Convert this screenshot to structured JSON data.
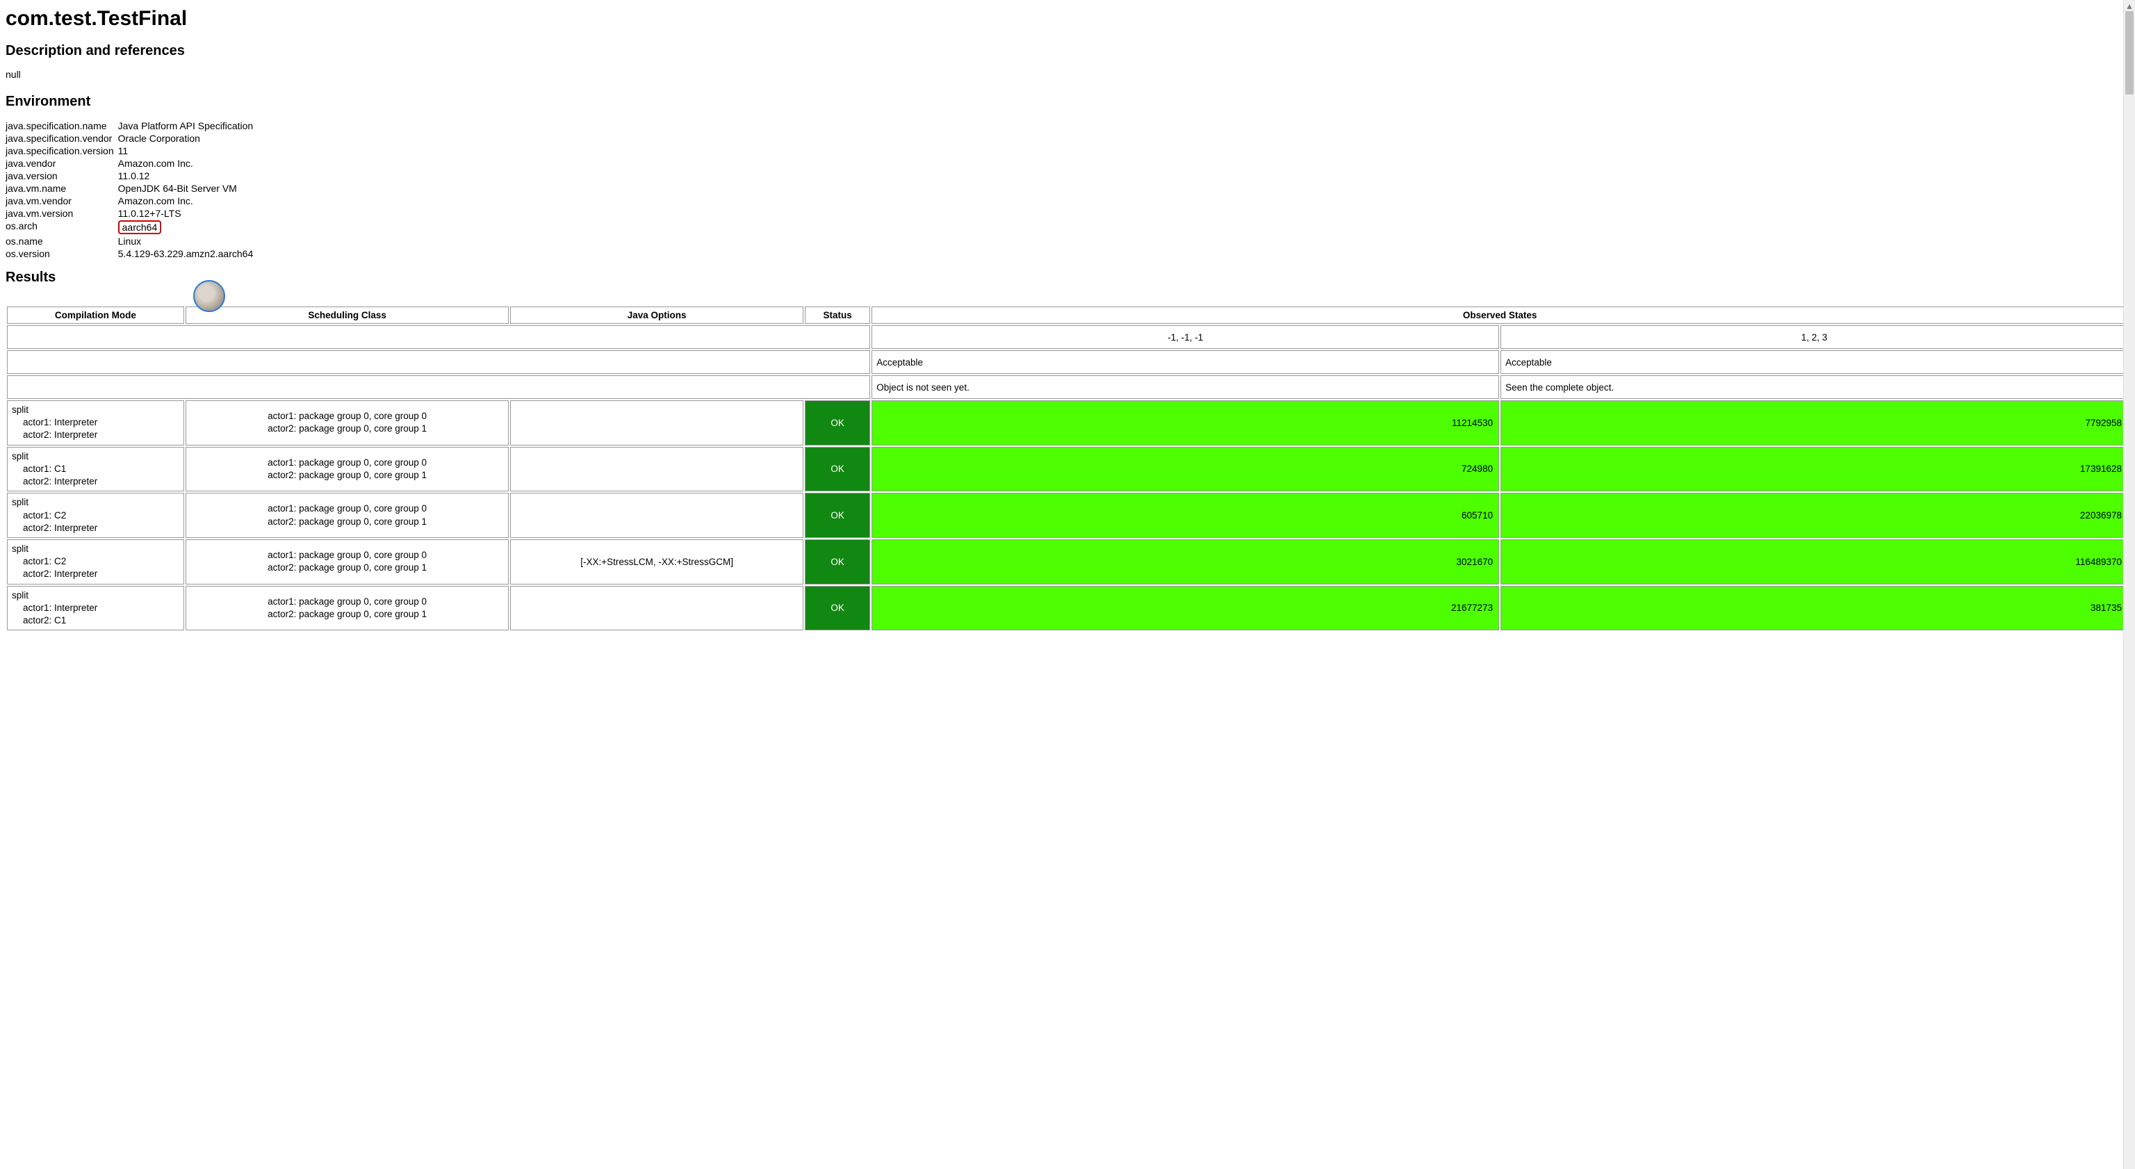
{
  "title": "com.test.TestFinal",
  "sections": {
    "description_heading": "Description and references",
    "description_text": "null",
    "environment_heading": "Environment",
    "results_heading": "Results"
  },
  "environment": [
    {
      "key": "java.specification.name",
      "value": "Java Platform API Specification"
    },
    {
      "key": "java.specification.vendor",
      "value": "Oracle Corporation"
    },
    {
      "key": "java.specification.version",
      "value": "11"
    },
    {
      "key": "java.vendor",
      "value": "Amazon.com Inc."
    },
    {
      "key": "java.version",
      "value": "11.0.12"
    },
    {
      "key": "java.vm.name",
      "value": "OpenJDK 64-Bit Server VM"
    },
    {
      "key": "java.vm.vendor",
      "value": "Amazon.com Inc."
    },
    {
      "key": "java.vm.version",
      "value": "11.0.12+7-LTS"
    },
    {
      "key": "os.arch",
      "value": "aarch64",
      "highlight": true
    },
    {
      "key": "os.name",
      "value": "Linux"
    },
    {
      "key": "os.version",
      "value": "5.4.129-63.229.amzn2.aarch64"
    }
  ],
  "results_table": {
    "headers": {
      "compilation_mode": "Compilation Mode",
      "scheduling_class": "Scheduling Class",
      "java_options": "Java Options",
      "status": "Status",
      "observed_states": "Observed States"
    },
    "observed_headers": [
      "-1, -1, -1",
      "1, 2, 3"
    ],
    "observed_acceptable": [
      "Acceptable",
      "Acceptable"
    ],
    "observed_desc": [
      "Object is not seen yet.",
      "Seen the complete object."
    ],
    "rows": [
      {
        "comp_line1": "split",
        "comp_actor1": "actor1: Interpreter",
        "comp_actor2": "actor2: Interpreter",
        "sched_actor1": "actor1: package group 0, core group 0",
        "sched_actor2": "actor2: package group 0, core group 1",
        "java_options": "",
        "status": "OK",
        "obs": [
          "11214530",
          "7792958"
        ]
      },
      {
        "comp_line1": "split",
        "comp_actor1": "actor1: C1",
        "comp_actor2": "actor2: Interpreter",
        "sched_actor1": "actor1: package group 0, core group 0",
        "sched_actor2": "actor2: package group 0, core group 1",
        "java_options": "",
        "status": "OK",
        "obs": [
          "724980",
          "17391628"
        ]
      },
      {
        "comp_line1": "split",
        "comp_actor1": "actor1: C2",
        "comp_actor2": "actor2: Interpreter",
        "sched_actor1": "actor1: package group 0, core group 0",
        "sched_actor2": "actor2: package group 0, core group 1",
        "java_options": "",
        "status": "OK",
        "obs": [
          "605710",
          "22036978"
        ]
      },
      {
        "comp_line1": "split",
        "comp_actor1": "actor1: C2",
        "comp_actor2": "actor2: Interpreter",
        "sched_actor1": "actor1: package group 0, core group 0",
        "sched_actor2": "actor2: package group 0, core group 1",
        "java_options": "[-XX:+StressLCM, -XX:+StressGCM]",
        "status": "OK",
        "obs": [
          "3021670",
          "116489370"
        ]
      },
      {
        "comp_line1": "split",
        "comp_actor1": "actor1: Interpreter",
        "comp_actor2": "actor2: C1",
        "sched_actor1": "actor1: package group 0, core group 0",
        "sched_actor2": "actor2: package group 0, core group 1",
        "java_options": "",
        "status": "OK",
        "obs": [
          "21677273",
          "381735"
        ]
      }
    ]
  }
}
